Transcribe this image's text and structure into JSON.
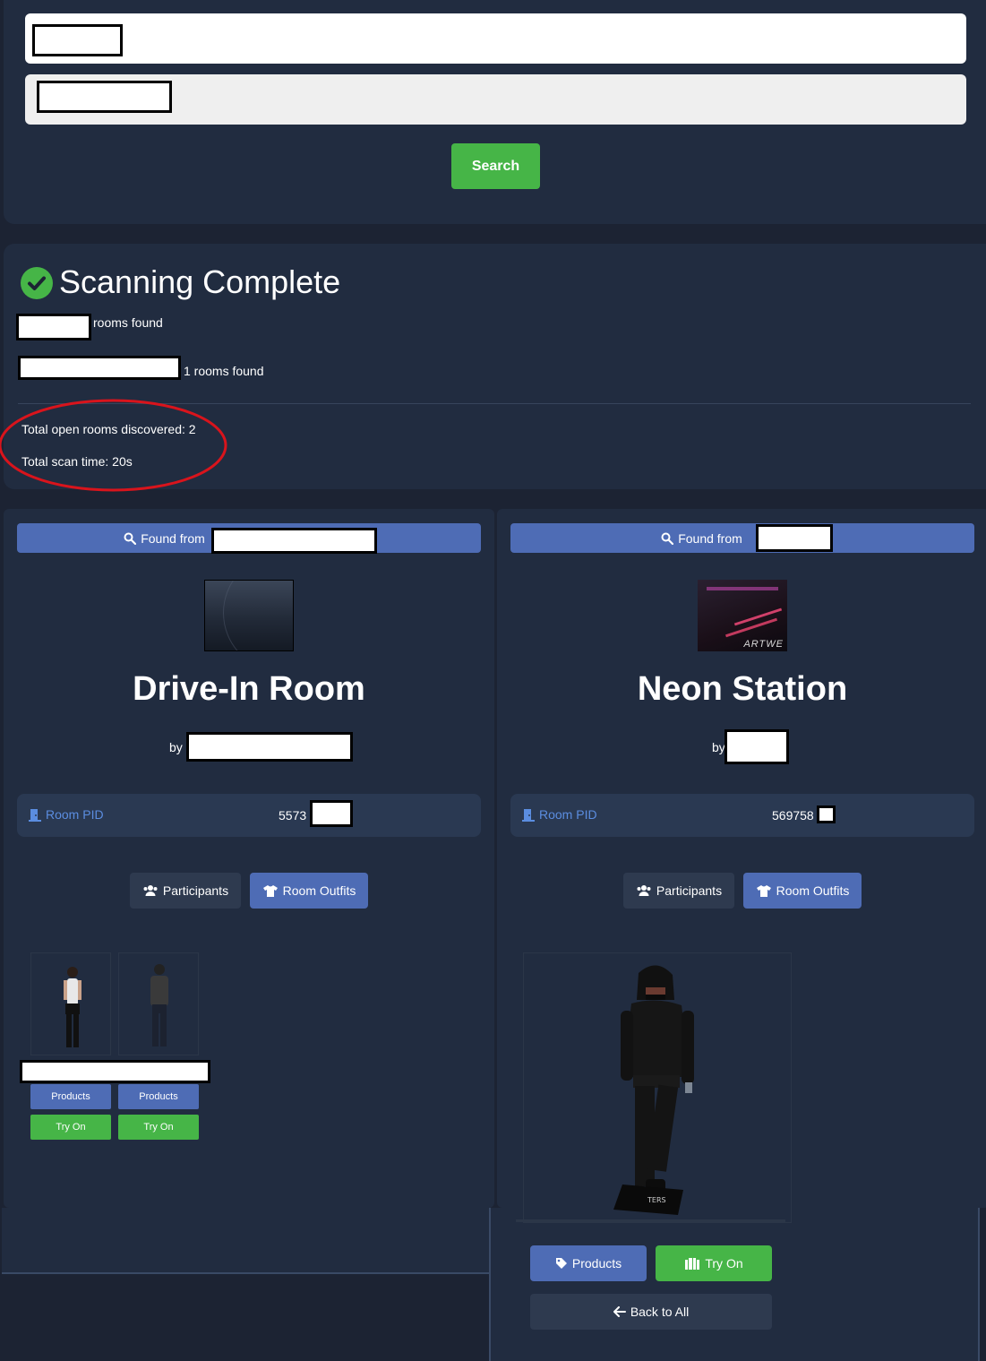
{
  "search": {
    "button_label": "Search"
  },
  "scan": {
    "title": "Scanning Complete",
    "lines": [
      "rooms found",
      "1 rooms found"
    ],
    "total_open": "Total open rooms discovered: 2",
    "total_time": "Total scan time: 20s"
  },
  "rooms": [
    {
      "found_label": "Found from",
      "title": "Drive-In Room",
      "by_label": "by (",
      "pid_label": "Room PID",
      "pid_value": "5573",
      "participants_label": "Participants",
      "outfits_label": "Room Outfits",
      "participants": [
        {
          "products_label": "Products",
          "tryon_label": "Try On"
        },
        {
          "products_label": "Products",
          "tryon_label": "Try On"
        }
      ]
    },
    {
      "found_label": "Found from",
      "title": "Neon Station",
      "by_label": "by",
      "pid_label": "Room PID",
      "pid_value": "569758",
      "participants_label": "Participants",
      "outfits_label": "Room Outfits",
      "outfit": {
        "products_label": "Products",
        "tryon_label": "Try On",
        "back_label": "Back to All",
        "thumbnail_text": "ARTWE"
      }
    }
  ],
  "colors": {
    "background": "#1c2333",
    "panel": "#212c40",
    "accent_blue": "#4e6cb5",
    "success_green": "#46b547",
    "highlight_ring": "#d9141c"
  }
}
